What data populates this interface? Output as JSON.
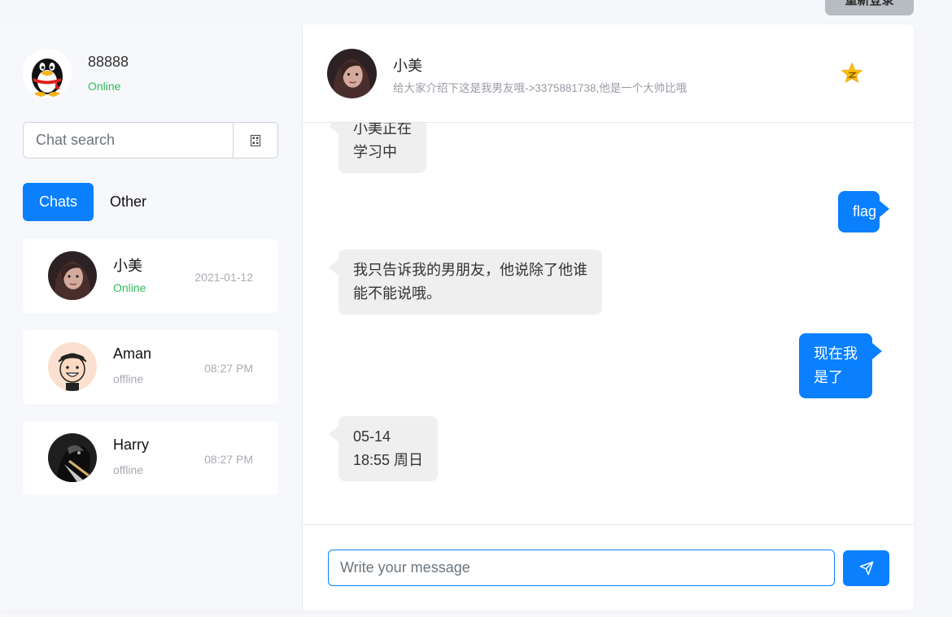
{
  "top_action": {
    "label": "重新登录"
  },
  "me": {
    "name": "88888",
    "status": "Online",
    "avatar": "qq-penguin-icon"
  },
  "search": {
    "placeholder": "Chat search",
    "button_icon": "qr-code-icon"
  },
  "tabs": [
    {
      "label": "Chats",
      "active": true
    },
    {
      "label": "Other",
      "active": false
    }
  ],
  "contacts": [
    {
      "name": "小美",
      "status": "Online",
      "time": "2021-01-12"
    },
    {
      "name": "Aman",
      "status": "offline",
      "time": "08:27 PM"
    },
    {
      "name": "Harry",
      "status": "offline",
      "time": "08:27 PM"
    }
  ],
  "chat": {
    "name": "小美",
    "bio": "给大家介绍下这是我男友哦->3375881738,他是一个大帅比哦",
    "star_icon": "star-icon"
  },
  "messages": [
    {
      "dir": "in",
      "lines": [
        "小美正在",
        "学习中"
      ]
    },
    {
      "dir": "out",
      "lines": [
        "flag"
      ]
    },
    {
      "dir": "in",
      "lines": [
        "我只告诉我的男朋友，他说除了他谁",
        "能不能说哦。"
      ]
    },
    {
      "dir": "out",
      "lines": [
        "现在我",
        "是了"
      ]
    },
    {
      "dir": "in",
      "lines": [
        "05-14",
        "18:55 周日"
      ]
    }
  ],
  "composer": {
    "placeholder": "Write your message",
    "send_icon": "send-icon"
  },
  "colors": {
    "accent": "#0a80ff",
    "online": "#2ebd59",
    "incoming_bubble": "#efefef"
  }
}
